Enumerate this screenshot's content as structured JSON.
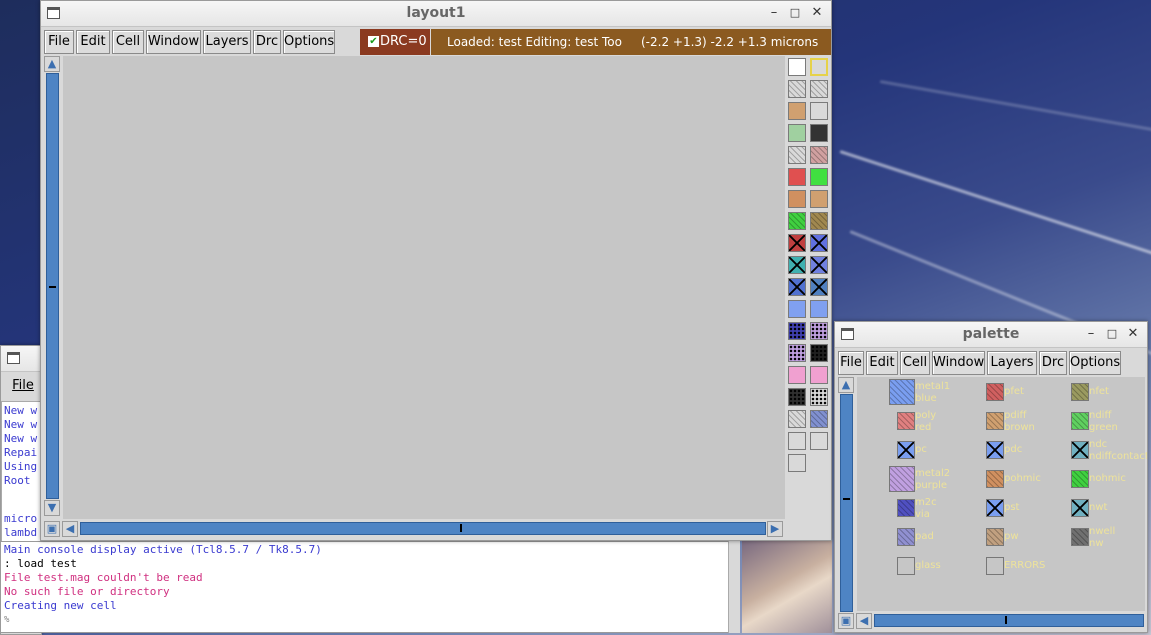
{
  "layout_window": {
    "title": "layout1",
    "menu": [
      "File",
      "Edit",
      "Cell",
      "Window",
      "Layers",
      "Drc",
      "Options"
    ],
    "drc_label": "DRC=0",
    "status": "Loaded: test Editing: test Too",
    "coords": "(-2.2 +1.3) -2.2 +1.3 microns"
  },
  "palette_window": {
    "title": "palette",
    "menu": [
      "File",
      "Edit",
      "Cell",
      "Window",
      "Layers",
      "Drc",
      "Options"
    ],
    "items": [
      {
        "l1": "metal1",
        "l2": "blue",
        "color": "#7a9ef0"
      },
      {
        "l1": "pfet",
        "l2": "",
        "color": "#d06060"
      },
      {
        "l1": "nfet",
        "l2": "",
        "color": "#9a9a60"
      },
      {
        "l1": "poly",
        "l2": "red",
        "color": "#e08080"
      },
      {
        "l1": "pdiff",
        "l2": "brown",
        "color": "#d0a070"
      },
      {
        "l1": "ndiff",
        "l2": "green",
        "color": "#60d060"
      },
      {
        "l1": "pc",
        "l2": "",
        "color": "#7a9ef0"
      },
      {
        "l1": "pdc",
        "l2": "",
        "color": "#7a9ef0"
      },
      {
        "l1": "ndc",
        "l2": "ndiffcontact",
        "color": "#70b0c0"
      },
      {
        "l1": "metal2",
        "l2": "purple",
        "color": "#c0a0e0"
      },
      {
        "l1": "pohmic",
        "l2": "",
        "color": "#d09060"
      },
      {
        "l1": "nohmic",
        "l2": "",
        "color": "#40d040"
      },
      {
        "l1": "m2c",
        "l2": "via",
        "color": "#5050c0"
      },
      {
        "l1": "pst",
        "l2": "",
        "color": "#7a9ef0"
      },
      {
        "l1": "nwt",
        "l2": "",
        "color": "#70b0c0"
      },
      {
        "l1": "pad",
        "l2": "",
        "color": "#9090d0"
      },
      {
        "l1": "pw",
        "l2": "",
        "color": "#c0a080"
      },
      {
        "l1": "nwell",
        "l2": "nw",
        "color": "#707070"
      },
      {
        "l1": "glass",
        "l2": "",
        "color": "#909090"
      },
      {
        "l1": "ERRORS",
        "l2": "",
        "color": "#ffffff"
      }
    ]
  },
  "console_window": {
    "menu_file": "File",
    "partial_lines": [
      "New w",
      "New w",
      "New w",
      "Repai",
      "Using",
      "Root"
    ],
    "partial_lines2": [
      "micro",
      "lambd"
    ],
    "lines": [
      {
        "text": "Main console display active (Tcl8.5.7 / Tk8.5.7)",
        "color": "#3a3ad0"
      },
      {
        "text": ": load test",
        "color": "#000000"
      },
      {
        "text": "File test.mag couldn't be read",
        "color": "#d03080"
      },
      {
        "text": "No such file or directory",
        "color": "#d03080"
      },
      {
        "text": "Creating new cell",
        "color": "#3a3ad0"
      }
    ],
    "prompt": "%"
  },
  "layer_colors": [
    [
      "#ffffff",
      "#d9d9d9"
    ],
    [
      "#d9d9d9",
      "#d9d9d9"
    ],
    [
      "#d0a070",
      "#d9d9d9"
    ],
    [
      "#a0d0a0",
      "#333333"
    ],
    [
      "#d9d9d9",
      "#d0a0a0"
    ],
    [
      "#e05050",
      "#40e040"
    ],
    [
      "#d09060",
      "#d0a070"
    ],
    [
      "#40d040",
      "#a08850"
    ],
    [
      "#c04040",
      "#6070e0"
    ],
    [
      "#40b0b0",
      "#7080e0"
    ],
    [
      "#5070d0",
      "#5080c0"
    ],
    [
      "#80a0f0",
      "#80a0f0"
    ],
    [
      "#4040b0",
      "#c0a0e0"
    ],
    [
      "#c0a0e0",
      "#202020"
    ],
    [
      "#f0a0d0",
      "#f0a0d0"
    ],
    [
      "#303030",
      "#d9d9d9"
    ],
    [
      "#d9d9d9",
      "#8090d0"
    ],
    [
      "#d9d9d9",
      "#d9d9d9"
    ],
    [
      "#d9d9d9",
      ""
    ]
  ]
}
